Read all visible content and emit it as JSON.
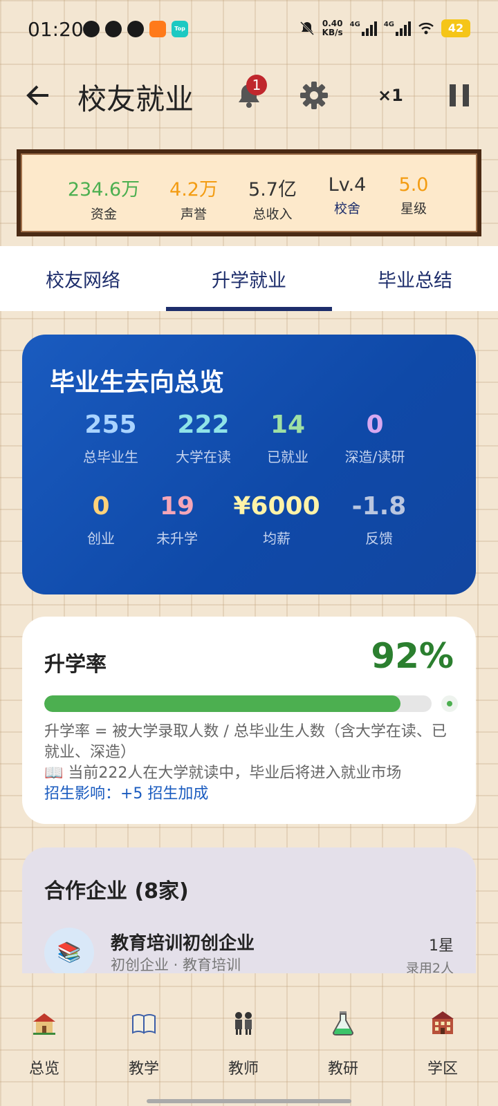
{
  "status_bar": {
    "time": "01:20",
    "net_speed": "0.40",
    "net_unit": "KB/s",
    "signal1": "4G",
    "signal2": "4G",
    "battery": "42",
    "app_badge": "Top"
  },
  "header": {
    "title": "校友就业",
    "notification_count": "1",
    "speed": "×1"
  },
  "stats": [
    {
      "value": "234.6万",
      "label": "资金",
      "color": "#4caf50"
    },
    {
      "value": "4.2万",
      "label": "声誉",
      "color": "#f39c12"
    },
    {
      "value": "5.7亿",
      "label": "总收入",
      "color": "#333333"
    },
    {
      "value": "Lv.4",
      "label": "校舍",
      "color": "#333333"
    },
    {
      "value": "5.0",
      "label": "星级",
      "color": "#f39c12"
    }
  ],
  "tabs": [
    {
      "label": "校友网络"
    },
    {
      "label": "升学就业"
    },
    {
      "label": "毕业总结"
    }
  ],
  "overview": {
    "title": "毕业生去向总览",
    "items": [
      {
        "value": "255",
        "label": "总毕业生",
        "color": "#a9d3ff"
      },
      {
        "value": "222",
        "label": "大学在读",
        "color": "#8fe3e8"
      },
      {
        "value": "14",
        "label": "已就业",
        "color": "#9fe0a4"
      },
      {
        "value": "0",
        "label": "深造/读研",
        "color": "#d7a8f0"
      },
      {
        "value": "0",
        "label": "创业",
        "color": "#ffd27a"
      },
      {
        "value": "19",
        "label": "未升学",
        "color": "#f4a6b8"
      },
      {
        "value": "¥6000",
        "label": "均薪",
        "color": "#fff3a8"
      },
      {
        "value": "-1.8",
        "label": "反馈",
        "color": "#b9c6e0"
      }
    ]
  },
  "rate": {
    "title": "升学率",
    "value": "92%",
    "progress": 0.92,
    "description": "升学率 = 被大学录取人数 / 总毕业生人数（含大学在读、已就业、深造）",
    "note": "📖 当前222人在大学就读中，毕业后将进入就业市场",
    "influence": "招生影响：+5 招生加成"
  },
  "partners": {
    "title": "合作企业 (8家)",
    "items": [
      {
        "icon": "📚",
        "name": "教育培训初创企业",
        "subtitle": "初创企业 · 教育培训",
        "stars": "1星",
        "hired": "录用2人"
      }
    ]
  },
  "bottom_nav": [
    {
      "label": "总览",
      "icon": "school-house-icon"
    },
    {
      "label": "教学",
      "icon": "book-icon"
    },
    {
      "label": "教师",
      "icon": "teachers-icon"
    },
    {
      "label": "教研",
      "icon": "flask-icon"
    },
    {
      "label": "学区",
      "icon": "building-icon"
    }
  ]
}
